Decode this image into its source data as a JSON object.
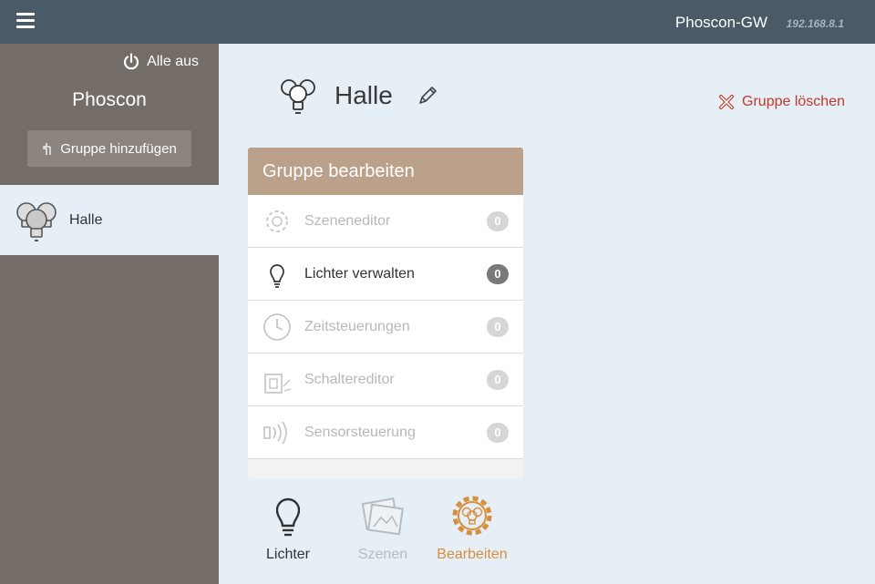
{
  "topbar": {
    "menu_icon": "hamburger-icon",
    "gateway_name": "Phoscon-GW",
    "gateway_ip": "192.168.8.1"
  },
  "sidebar": {
    "all_off_label": "Alle aus",
    "brand": "Phoscon",
    "add_group_label": "Gruppe hinzufügen",
    "groups": [
      {
        "label": "Halle",
        "icon": "bulbs-icon"
      }
    ]
  },
  "group": {
    "name": "Halle",
    "delete_label": "Gruppe löschen"
  },
  "panel": {
    "title": "Gruppe bearbeiten",
    "items": [
      {
        "label": "Szeneneditor",
        "count": "0",
        "enabled": false,
        "icon": "scene-editor-icon"
      },
      {
        "label": "Lichter verwalten",
        "count": "0",
        "enabled": true,
        "icon": "bulb-icon"
      },
      {
        "label": "Zeitsteuerungen",
        "count": "0",
        "enabled": false,
        "icon": "clock-icon"
      },
      {
        "label": "Schaltereditor",
        "count": "0",
        "enabled": false,
        "icon": "switch-icon"
      },
      {
        "label": "Sensorsteuerung",
        "count": "0",
        "enabled": false,
        "icon": "sensor-icon"
      }
    ]
  },
  "bottom_nav": {
    "lights_label": "Lichter",
    "scenes_label": "Szenen",
    "edit_label": "Bearbeiten"
  },
  "colors": {
    "topbar": "#4a5a66",
    "sidebar": "#746c66",
    "panel_header": "#bba18a",
    "delete": "#c0392b",
    "edit_active": "#d58f3d"
  }
}
